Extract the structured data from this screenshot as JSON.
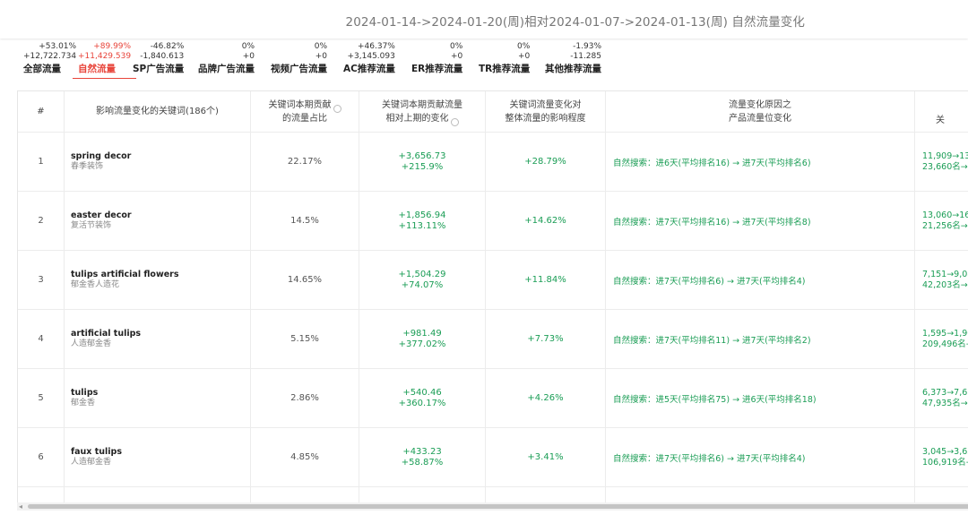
{
  "header": {
    "title": "2024-01-14->2024-01-20(周)相对2024-01-07->2024-01-13(周) 自然流量变化"
  },
  "tabs": [
    {
      "pct": "+53.01%",
      "abs": "+12,722.734",
      "label": "全部流量",
      "active": false
    },
    {
      "pct": "+89.99%",
      "abs": "+11,429.539",
      "label": "自然流量",
      "active": true
    },
    {
      "pct": "-46.82%",
      "abs": "-1,840.613",
      "label": "SP广告流量",
      "active": false
    },
    {
      "pct": "0%",
      "abs": "+0",
      "label": "品牌广告流量",
      "active": false
    },
    {
      "pct": "0%",
      "abs": "+0",
      "label": "视频广告流量",
      "active": false
    },
    {
      "pct": "+46.37%",
      "abs": "+3,145.093",
      "label": "AC推荐流量",
      "active": false
    },
    {
      "pct": "0%",
      "abs": "+0",
      "label": "ER推荐流量",
      "active": false
    },
    {
      "pct": "0%",
      "abs": "+0",
      "label": "TR推荐流量",
      "active": false
    },
    {
      "pct": "-1.93%",
      "abs": "-11.285",
      "label": "其他推荐流量",
      "active": false
    }
  ],
  "table": {
    "headers": {
      "index": "#",
      "keyword": "影响流量变化的关键词(186个)",
      "share_l1": "关键词本期贡献",
      "share_l2": "的流量占比",
      "contrib_l1": "关键词本期贡献流量",
      "contrib_l2": "相对上期的变化",
      "impact_l1": "关键词流量变化对",
      "impact_l2": "整体流量的影响程度",
      "reason_l1": "流量变化原因之",
      "reason_l2": "产品流量位变化",
      "next": "关"
    },
    "rows": [
      {
        "index": "1",
        "keyword": "spring decor",
        "keyword_cn": "春季装饰",
        "share": "22.17%",
        "contrib_abs": "+3,656.73",
        "contrib_pct": "+215.9%",
        "impact": "+28.79%",
        "reason": "自然搜索：进6天(平均排名16) → 进7天(平均排名6)",
        "rank1": "11,909→13,",
        "rank2": "23,660名→"
      },
      {
        "index": "2",
        "keyword": "easter decor",
        "keyword_cn": "复活节装饰",
        "share": "14.5%",
        "contrib_abs": "+1,856.94",
        "contrib_pct": "+113.11%",
        "impact": "+14.62%",
        "reason": "自然搜索：进7天(平均排名16) → 进7天(平均排名8)",
        "rank1": "13,060→16,",
        "rank2": "21,256名→"
      },
      {
        "index": "3",
        "keyword": "tulips artificial flowers",
        "keyword_cn": "郁金香人造花",
        "share": "14.65%",
        "contrib_abs": "+1,504.29",
        "contrib_pct": "+74.07%",
        "impact": "+11.84%",
        "reason": "自然搜索：进7天(平均排名6) → 进7天(平均排名4)",
        "rank1": "7,151→9,08",
        "rank2": "42,203名→"
      },
      {
        "index": "4",
        "keyword": "artificial tulips",
        "keyword_cn": "人造郁金香",
        "share": "5.15%",
        "contrib_abs": "+981.49",
        "contrib_pct": "+377.02%",
        "impact": "+7.73%",
        "reason": "自然搜索：进7天(平均排名11) → 进7天(平均排名2)",
        "rank1": "1,595→1,90",
        "rank2": "209,496名→"
      },
      {
        "index": "5",
        "keyword": "tulips",
        "keyword_cn": "郁金香",
        "share": "2.86%",
        "contrib_abs": "+540.46",
        "contrib_pct": "+360.17%",
        "impact": "+4.26%",
        "reason": "自然搜索：进5天(平均排名75) → 进6天(平均排名18)",
        "rank1": "6,373→7,65",
        "rank2": "47,935名→"
      },
      {
        "index": "6",
        "keyword": "faux tulips",
        "keyword_cn": "人造郁金香",
        "share": "4.85%",
        "contrib_abs": "+433.23",
        "contrib_pct": "+58.87%",
        "impact": "+3.41%",
        "reason": "自然搜索：进7天(平均排名6) → 进7天(平均排名4)",
        "rank1": "3,045→3,62",
        "rank2": "106,919名→"
      }
    ]
  },
  "colors": {
    "active_tab": "#e8443a",
    "positive": "#1a9d55"
  }
}
